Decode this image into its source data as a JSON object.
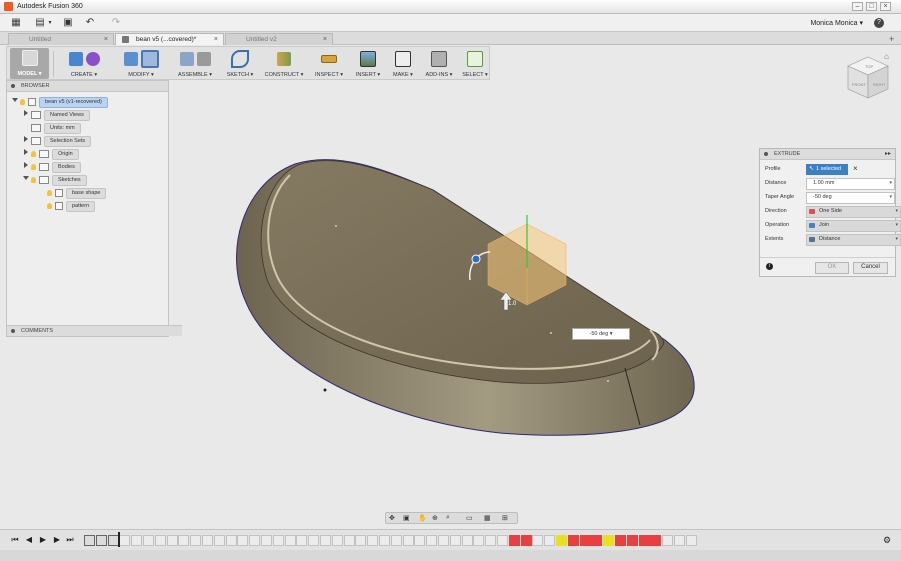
{
  "app": {
    "title": "Autodesk Fusion 360"
  },
  "user": {
    "name": "Monica Monica"
  },
  "tabs": [
    {
      "label": "Untitled",
      "active": false
    },
    {
      "label": "bean v5 (...covered)*",
      "active": true
    },
    {
      "label": "Untitled v2",
      "active": false
    }
  ],
  "toolbar": {
    "workspace": "MODEL",
    "groups": [
      "CREATE",
      "MODIFY",
      "ASSEMBLE",
      "SKETCH",
      "CONSTRUCT",
      "INSPECT",
      "INSERT",
      "MAKE",
      "ADD-INS",
      "SELECT"
    ]
  },
  "browser": {
    "title": "BROWSER",
    "root": "bean v5 (v1-recovered)",
    "items": [
      "Named Views",
      "Units: mm",
      "Selection Sets",
      "Origin",
      "Bodies",
      "Sketches"
    ],
    "sketches": [
      "base shape",
      "pattern"
    ],
    "comments_title": "COMMENTS"
  },
  "viewcube": {
    "faces": [
      "TOP",
      "FRONT",
      "RIGHT"
    ]
  },
  "extrude": {
    "title": "EXTRUDE",
    "rows": [
      {
        "label": "Profile",
        "value": "1 selected"
      },
      {
        "label": "Distance",
        "value": "1.00 mm"
      },
      {
        "label": "Taper Angle",
        "value": "-50 deg"
      },
      {
        "label": "Direction",
        "value": "One Side"
      },
      {
        "label": "Operation",
        "value": "Join"
      },
      {
        "label": "Extents",
        "value": "Distance"
      }
    ],
    "ok_label": "OK",
    "cancel_label": "Cancel"
  },
  "viewport": {
    "angle_input": "-50 deg",
    "distance_marker": "1.0"
  },
  "colors": {
    "body": "#7e735c",
    "selection": "#3b7fc7",
    "accent_orange": "#f05a28",
    "timeline_red": "#e84040",
    "timeline_yellow": "#e8e020"
  }
}
